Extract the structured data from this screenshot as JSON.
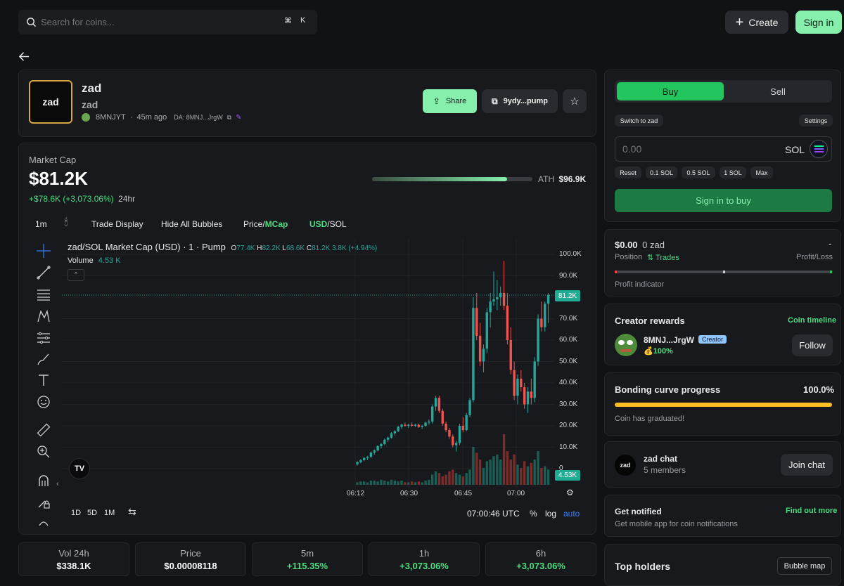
{
  "search": {
    "placeholder": "Search for coins...",
    "kbd1": "⌘",
    "kbd2": "K"
  },
  "header": {
    "create_label": "Create",
    "signin_label": "Sign in"
  },
  "coin": {
    "logo_text": "zad",
    "name": "zad",
    "ticker": "zad",
    "creator": "8MNJYT",
    "age": "45m ago",
    "da": "DA: 8MNJ...JrgW",
    "share_label": "Share",
    "address": "9ydy...pump"
  },
  "market": {
    "label": "Market Cap",
    "value": "$81.2K",
    "change": "+$78.6K (+3,073.06%)",
    "period": "24hr",
    "ath_label": "ATH",
    "ath_value": "$96.9K",
    "ath_progress": 0.84
  },
  "chart_toolbar": {
    "interval": "1m",
    "trade_display": "Trade Display",
    "hide_bubbles": "Hide All Bubbles",
    "price_label": "Price/",
    "mcap_label": "MCap",
    "usd_label": "USD",
    "sol_label": "/SOL"
  },
  "chart_legend": {
    "title": "zad/SOL Market Cap (USD) · 1 · Pump",
    "o_label": "O",
    "o": "77.4K",
    "h_label": "H",
    "h": "82.2K",
    "l_label": "L",
    "l": "68.6K",
    "c_label": "C",
    "c": "81.2K",
    "change": "3.8K (+4.94%)",
    "volume_label": "Volume",
    "volume_value": "4.53 K"
  },
  "chart_footer": {
    "r1d": "1D",
    "r5d": "5D",
    "r1m": "1M",
    "time": "07:00:46 UTC",
    "pct": "%",
    "log": "log",
    "auto": "auto"
  },
  "chart_data": {
    "type": "candlestick",
    "title": "zad/SOL Market Cap (USD) · 1 · Pump",
    "y_ticks": [
      "100.0K",
      "90.0K",
      "80.0K",
      "70.0K",
      "60.0K",
      "50.0K",
      "40.0K",
      "30.0K",
      "20.0K",
      "10.0K",
      "0"
    ],
    "ylim": [
      0,
      100000
    ],
    "x_ticks": [
      "06:12",
      "06:30",
      "06:45",
      "07:00"
    ],
    "last_price_label": "81.2K",
    "last_volume_label": "4.53K",
    "candles": [
      [
        2000,
        3500,
        1500,
        3000
      ],
      [
        3000,
        4500,
        2500,
        4000
      ],
      [
        4000,
        5500,
        3500,
        5000
      ],
      [
        5000,
        6000,
        4000,
        5500
      ],
      [
        5500,
        8000,
        5000,
        7500
      ],
      [
        7500,
        9000,
        6500,
        8500
      ],
      [
        8500,
        11000,
        8000,
        10500
      ],
      [
        10500,
        12000,
        9500,
        11500
      ],
      [
        11500,
        14000,
        11000,
        13500
      ],
      [
        13500,
        15000,
        12500,
        14500
      ],
      [
        14500,
        17000,
        14000,
        16500
      ],
      [
        16500,
        18000,
        15500,
        17500
      ],
      [
        17500,
        20000,
        17000,
        19500
      ],
      [
        19500,
        21000,
        18500,
        20500
      ],
      [
        20500,
        21500,
        19500,
        20000
      ],
      [
        20000,
        21000,
        19000,
        20500
      ],
      [
        20500,
        21500,
        19500,
        20000
      ],
      [
        20000,
        21000,
        19500,
        20500
      ],
      [
        20500,
        21000,
        19000,
        19500
      ],
      [
        19500,
        20500,
        18500,
        20000
      ],
      [
        20000,
        22000,
        19500,
        21500
      ],
      [
        21500,
        23000,
        20500,
        22000
      ],
      [
        22000,
        30000,
        21000,
        29000
      ],
      [
        29000,
        34000,
        27000,
        33000
      ],
      [
        33000,
        34000,
        26000,
        27000
      ],
      [
        27000,
        28000,
        20000,
        21000
      ],
      [
        21000,
        22000,
        17000,
        18000
      ],
      [
        18000,
        19000,
        14000,
        15000
      ],
      [
        15000,
        16000,
        10000,
        11000
      ],
      [
        11000,
        13000,
        8000,
        12000
      ],
      [
        12000,
        21000,
        11000,
        20000
      ],
      [
        20000,
        24000,
        17000,
        18000
      ],
      [
        18000,
        26000,
        17500,
        25000
      ],
      [
        25000,
        33000,
        24000,
        32000
      ],
      [
        32000,
        80000,
        31000,
        75000
      ],
      [
        75000,
        82000,
        60000,
        62000
      ],
      [
        62000,
        68000,
        48000,
        50000
      ],
      [
        50000,
        58000,
        45000,
        56000
      ],
      [
        56000,
        75000,
        54000,
        73000
      ],
      [
        73000,
        82000,
        66000,
        78000
      ],
      [
        78000,
        92000,
        76000,
        79000
      ],
      [
        79000,
        88000,
        74000,
        80000
      ],
      [
        80000,
        85000,
        76000,
        82000
      ],
      [
        82000,
        97000,
        74000,
        76000
      ],
      [
        76000,
        82000,
        58000,
        60000
      ],
      [
        60000,
        66000,
        44000,
        46000
      ],
      [
        46000,
        50000,
        32000,
        34000
      ],
      [
        34000,
        44000,
        30000,
        42000
      ],
      [
        42000,
        46000,
        36000,
        38000
      ],
      [
        38000,
        40000,
        28000,
        30000
      ],
      [
        30000,
        38000,
        26000,
        36000
      ],
      [
        36000,
        42000,
        30000,
        33000
      ],
      [
        33000,
        52000,
        31000,
        50000
      ],
      [
        50000,
        72000,
        48000,
        70000
      ],
      [
        70000,
        78000,
        64000,
        66000
      ],
      [
        66000,
        78000,
        64000,
        77000
      ],
      [
        77000,
        82000,
        68000,
        81000
      ]
    ],
    "volumes": [
      3,
      4,
      4,
      3,
      5,
      5,
      4,
      6,
      5,
      4,
      6,
      5,
      4,
      5,
      3,
      3,
      4,
      3,
      4,
      3,
      5,
      6,
      12,
      16,
      14,
      10,
      12,
      16,
      18,
      14,
      12,
      10,
      14,
      18,
      45,
      38,
      30,
      20,
      28,
      30,
      34,
      36,
      30,
      60,
      40,
      30,
      36,
      24,
      20,
      28,
      22,
      26,
      30,
      40,
      20,
      22,
      18
    ]
  },
  "trade": {
    "buy_label": "Buy",
    "sell_label": "Sell",
    "switch_label": "Switch to zad",
    "settings_label": "Settings",
    "amount_placeholder": "0.00",
    "currency": "SOL",
    "quick": [
      "Reset",
      "0.1 SOL",
      "0.5 SOL",
      "1 SOL",
      "Max"
    ],
    "signin_buy_label": "Sign in to buy"
  },
  "position": {
    "value": "$0.00",
    "unit": "0 zad",
    "dash": "-",
    "position_label": "Position",
    "trades_label": "Trades",
    "pnl_label": "Profit/Loss",
    "indicator_label": "Profit indicator"
  },
  "creator_rewards": {
    "title": "Creator rewards",
    "timeline_label": "Coin timeline",
    "name": "8MNJ...JrgW",
    "badge": "Creator",
    "percent": "100%",
    "follow_label": "Follow"
  },
  "bonding": {
    "title": "Bonding curve progress",
    "percent": "100.0%",
    "progress": 1.0,
    "note": "Coin has graduated!"
  },
  "chat": {
    "avatar_text": "zad",
    "title": "zad chat",
    "members": "5 members",
    "join_label": "Join chat"
  },
  "notify": {
    "title": "Get notified",
    "link": "Find out more",
    "desc": "Get mobile app for coin notifications"
  },
  "holders": {
    "title": "Top holders",
    "bubble_label": "Bubble map"
  },
  "stats": [
    {
      "label": "Vol 24h",
      "value": "$338.1K",
      "color": "#ffffff"
    },
    {
      "label": "Price",
      "value": "$0.00008118",
      "color": "#ffffff"
    },
    {
      "label": "5m",
      "value": "+115.35%",
      "color": "#4ade80"
    },
    {
      "label": "1h",
      "value": "+3,073.06%",
      "color": "#4ade80"
    },
    {
      "label": "6h",
      "value": "+3,073.06%",
      "color": "#4ade80"
    }
  ],
  "colors": {
    "accent": "#86efac",
    "buy": "#22c55e",
    "up": "#26a69a",
    "down": "#ef5350",
    "bonding": "#fbbf24"
  }
}
